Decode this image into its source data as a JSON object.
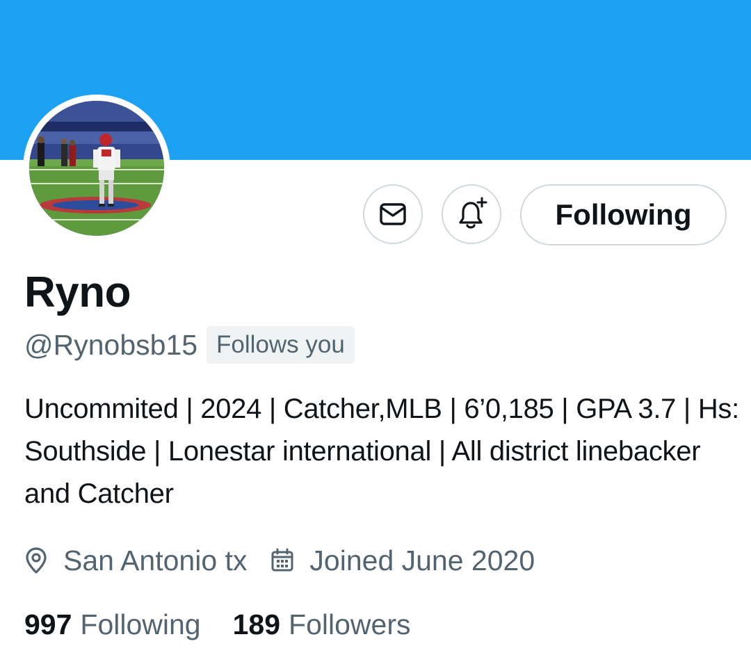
{
  "profile": {
    "display_name": "Ryno",
    "handle": "@Rynobsb15",
    "follows_you_badge": "Follows you",
    "bio": "Uncommited | 2024 | Catcher,MLB | 6’0,185 | GPA 3.7 | Hs: Southside | Lonestar international | All district linebacker and Catcher",
    "location": "San Antonio tx",
    "joined": "Joined June 2020"
  },
  "actions": {
    "message_icon": "envelope-icon",
    "notify_icon": "bell-plus-icon",
    "following_label": "Following"
  },
  "stats": {
    "following_count": "997",
    "following_label": "Following",
    "followers_count": "189",
    "followers_label": "Followers"
  },
  "icons": {
    "location": "location-pin-icon",
    "joined": "calendar-icon"
  },
  "colors": {
    "banner": "#1da1f2",
    "primary_text": "#0f1419",
    "secondary_text": "#536471",
    "border": "#cfd9de",
    "badge_bg": "#eff3f4"
  }
}
